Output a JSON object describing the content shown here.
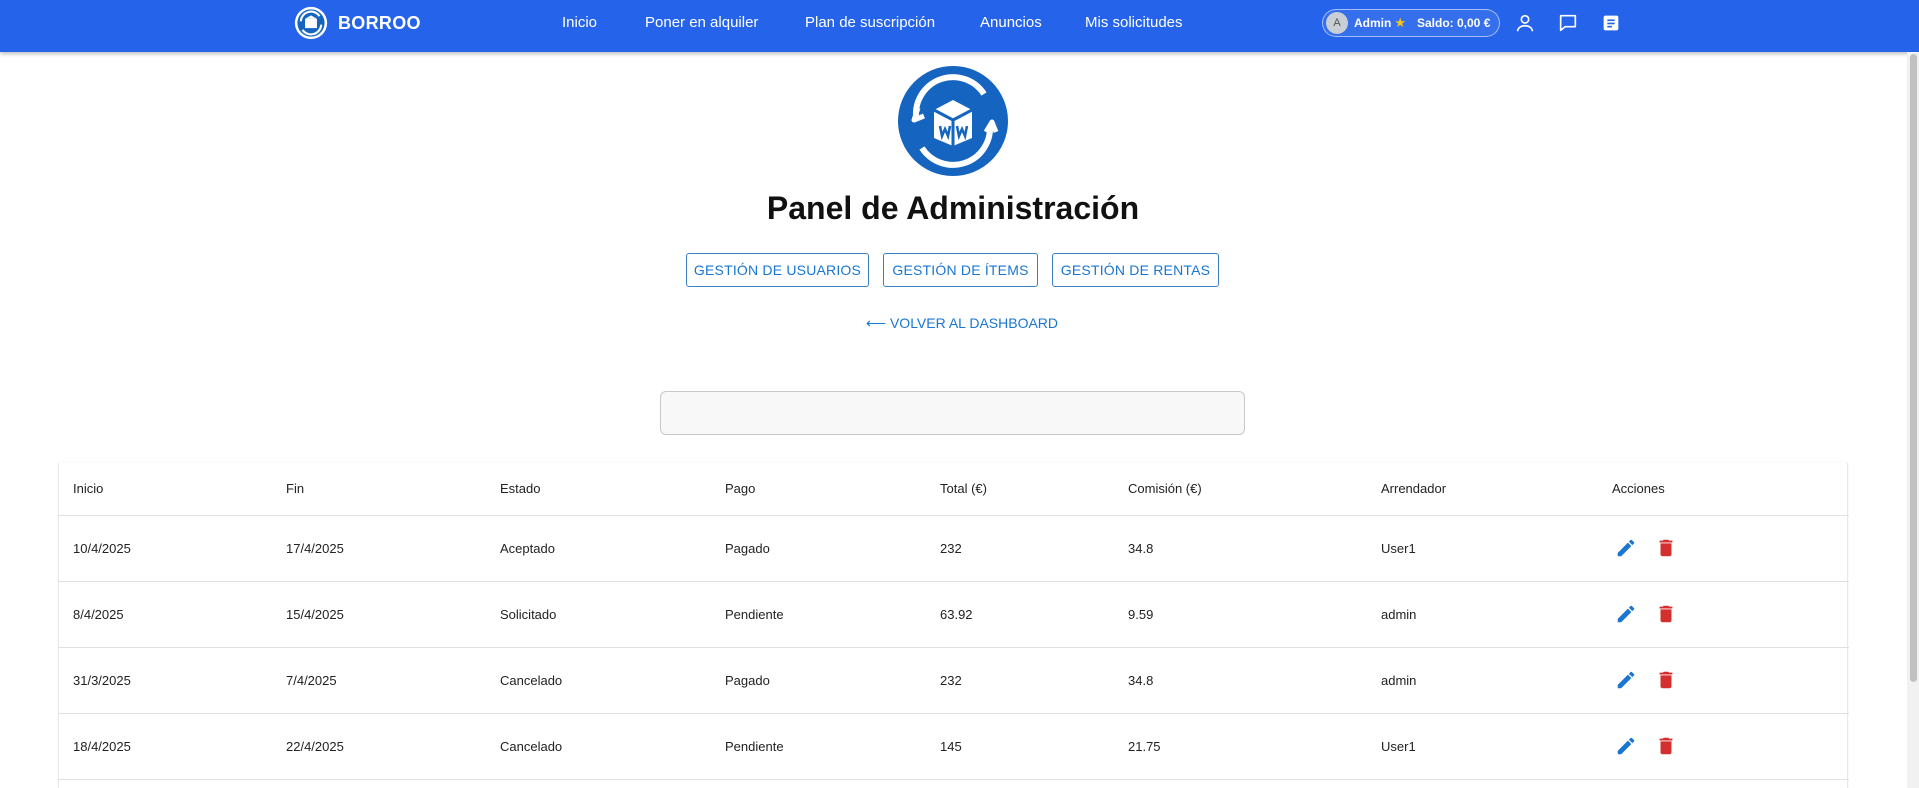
{
  "app": {
    "brand_name": "BORROO"
  },
  "nav": {
    "links": [
      "Inicio",
      "Poner en alquiler",
      "Plan de suscripción",
      "Anuncios",
      "Mis solicitudes"
    ]
  },
  "user_menu": {
    "avatar_initial": "A",
    "username": "Admin",
    "star": "★",
    "balance": "Saldo: 0,00 €",
    "icons": [
      "profile-icon",
      "chat-icon",
      "notes-icon"
    ]
  },
  "page": {
    "title": "Panel de Administración",
    "buttons": [
      "GESTIÓN DE USUARIOS",
      "GESTIÓN DE ÍTEMS",
      "GESTIÓN DE RENTAS"
    ],
    "back_link": "⟵ VOLVER AL DASHBOARD"
  },
  "search": {
    "value": "",
    "placeholder": ""
  },
  "table": {
    "headers": [
      "Inicio",
      "Fin",
      "Estado",
      "Pago",
      "Total (€)",
      "Comisión (€)",
      "Arrendador",
      "Acciones"
    ],
    "rows": [
      [
        "10/4/2025",
        "17/4/2025",
        "Aceptado",
        "Pagado",
        "232",
        "34.8",
        "User1"
      ],
      [
        "8/4/2025",
        "15/4/2025",
        "Solicitado",
        "Pendiente",
        "63.92",
        "9.59",
        "admin"
      ],
      [
        "31/3/2025",
        "7/4/2025",
        "Cancelado",
        "Pagado",
        "232",
        "34.8",
        "admin"
      ],
      [
        "18/4/2025",
        "22/4/2025",
        "Cancelado",
        "Pendiente",
        "145",
        "21.75",
        "User1"
      ]
    ],
    "action_icons": [
      "edit-icon",
      "delete-icon"
    ]
  },
  "colors": {
    "navbar": "#2563eb",
    "accent": "#1976d2",
    "danger": "#d32f2f"
  }
}
